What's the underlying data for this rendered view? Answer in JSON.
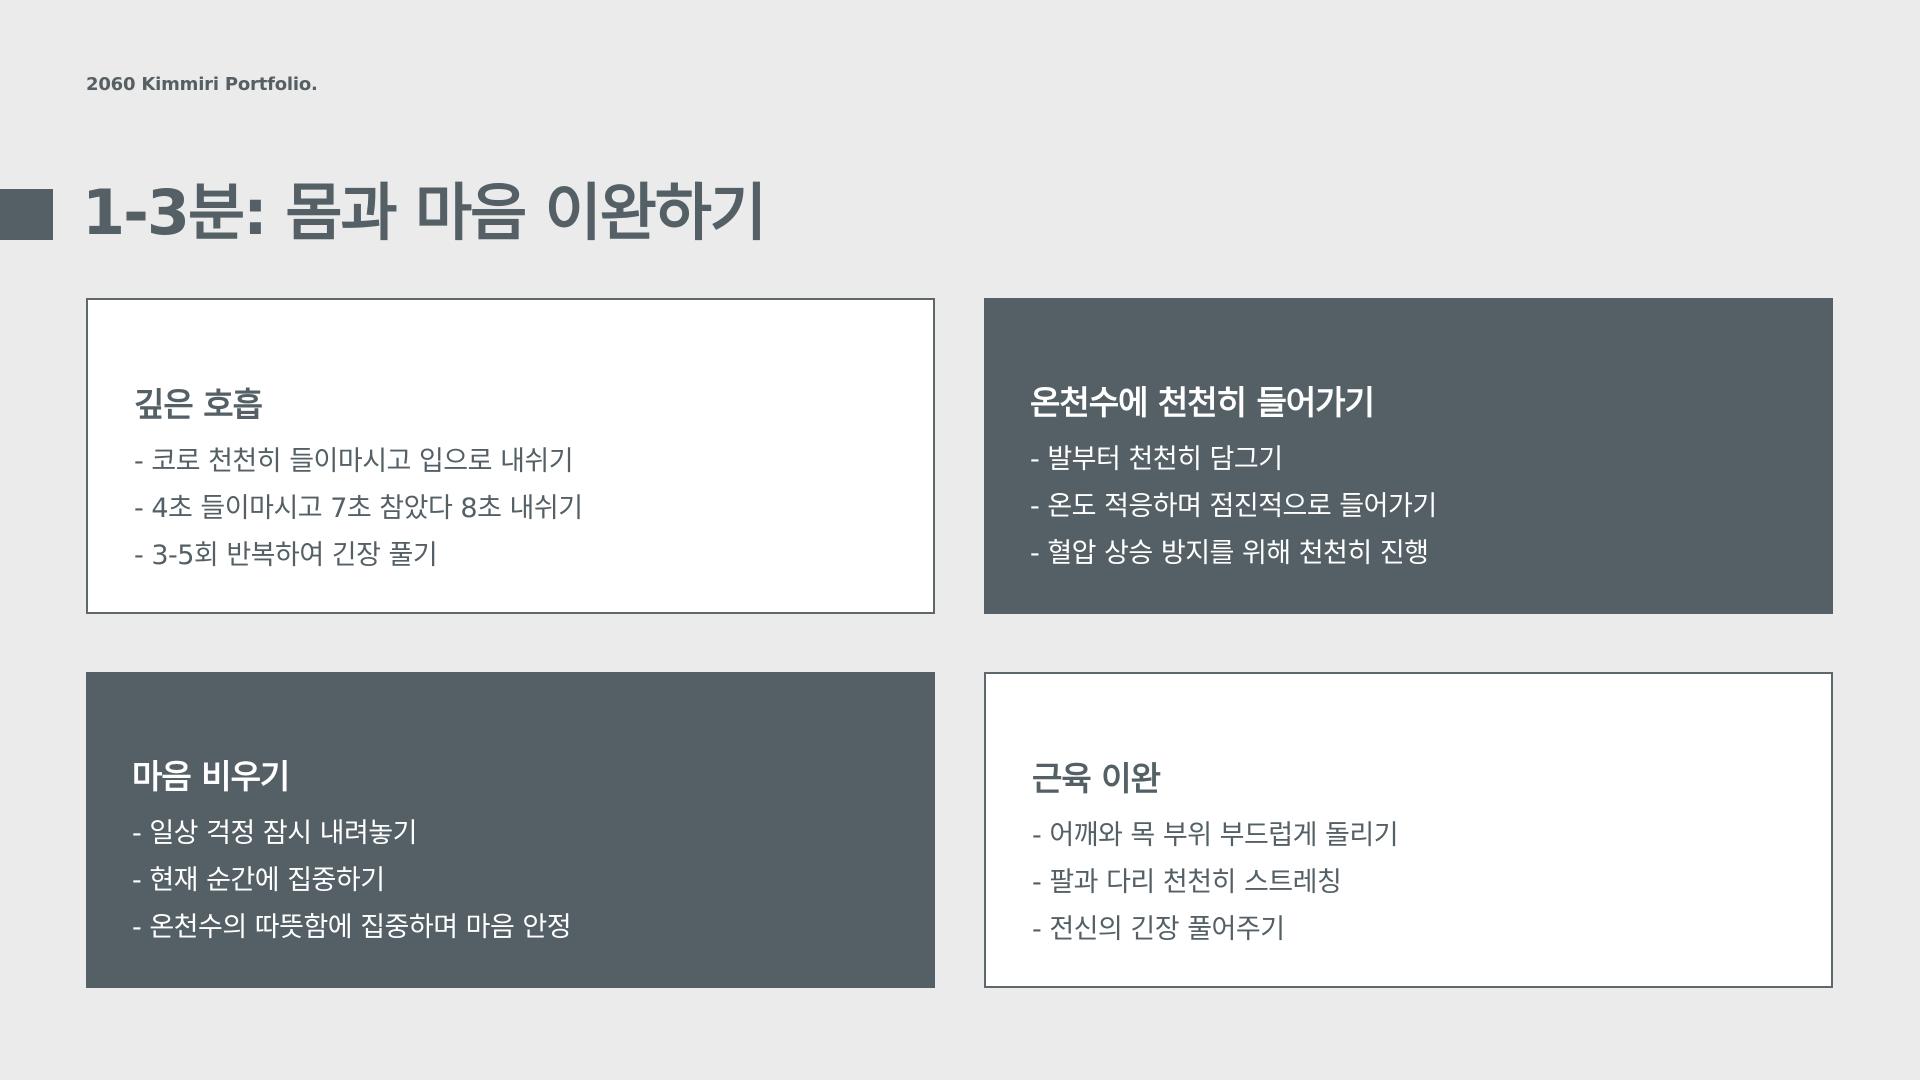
{
  "header": {
    "brand": "2060 Kimmiri Portfolio."
  },
  "page": {
    "title": "1-3분: 몸과 마음 이완하기"
  },
  "cards": [
    {
      "title": "깊은 호흡",
      "items": [
        "- 코로 천천히 들이마시고 입으로 내쉬기",
        "- 4초 들이마시고 7초 참았다 8초 내쉬기",
        "- 3-5회 반복하여 긴장 풀기"
      ]
    },
    {
      "title": "온천수에 천천히 들어가기",
      "items": [
        "- 발부터 천천히 담그기",
        "- 온도 적응하며 점진적으로 들어가기",
        "- 혈압 상승 방지를 위해 천천히 진행"
      ]
    },
    {
      "title": "마음 비우기",
      "items": [
        "- 일상 걱정 잠시 내려놓기",
        "- 현재 순간에 집중하기",
        "- 온천수의 따뜻함에 집중하며 마음 안정"
      ]
    },
    {
      "title": "근육 이완",
      "items": [
        "- 어깨와 목 부위 부드럽게 돌리기",
        "- 팔과 다리 천천히 스트레칭",
        "- 전신의 긴장 풀어주기"
      ]
    }
  ],
  "colors": {
    "background": "#ebebeb",
    "accent": "#546066",
    "card_light": "#ffffff"
  }
}
